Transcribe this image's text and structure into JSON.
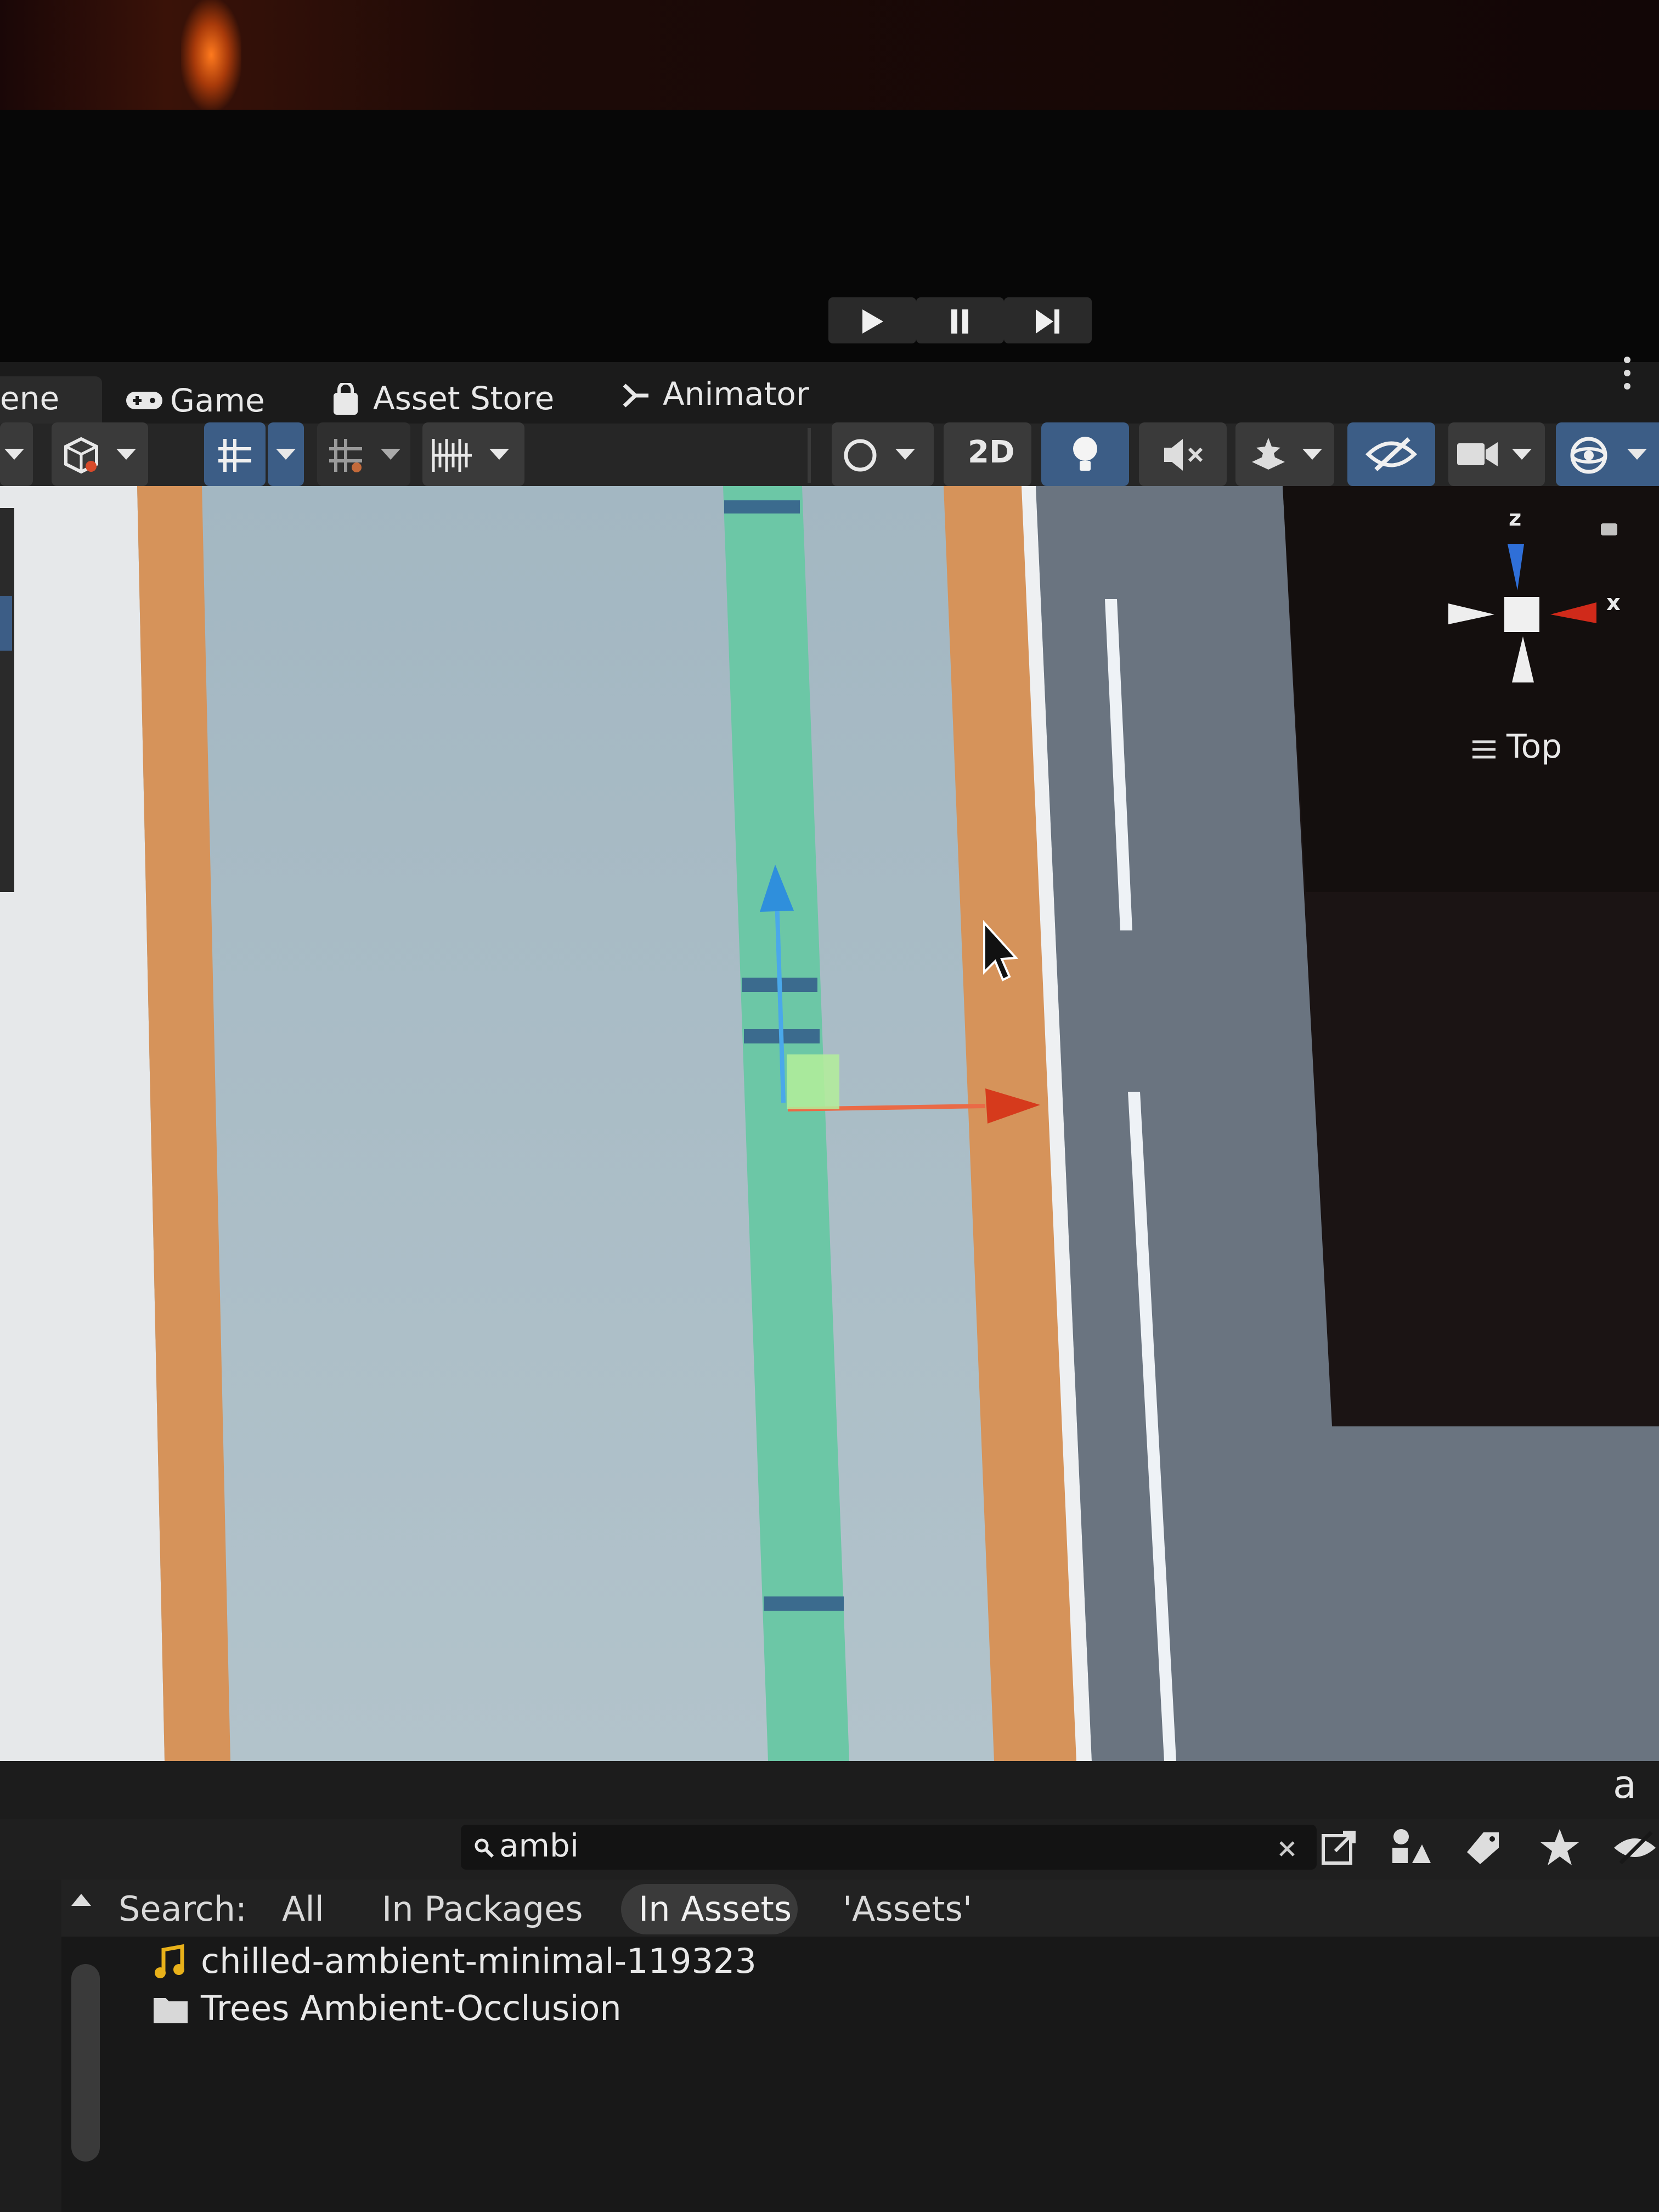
{
  "playbar": {
    "play_icon": "play-icon",
    "pause_icon": "pause-icon",
    "step_icon": "step-icon"
  },
  "tabs": [
    {
      "label": "ene",
      "icon": "scene-icon"
    },
    {
      "label": "Game",
      "icon": "gamepad-icon"
    },
    {
      "label": "Asset Store",
      "icon": "shopping-bag-icon"
    },
    {
      "label": "Animator",
      "icon": "animator-icon"
    }
  ],
  "scene_toolbar": {
    "label_2d": "2D",
    "items": [
      "draw-mode-icon",
      "grid-snap-icon",
      "grid-icon",
      "increment-snap-icon",
      "shading-mode-icon",
      "lighting-icon",
      "audio-icon",
      "effects-icon",
      "hidden-objects-icon",
      "camera-icon",
      "gizmos-icon"
    ]
  },
  "gizmo": {
    "axis_z": "z",
    "axis_x": "x",
    "view_label": "Top"
  },
  "project": {
    "search_value": "ambi",
    "search_label": "Search:",
    "scopes": [
      "All",
      "In Packages",
      "In Assets",
      "'Assets'"
    ],
    "active_scope": "In Assets",
    "results": [
      {
        "name": "chilled-ambient-minimal-119323",
        "icon": "audio-clip-icon"
      },
      {
        "name": "Trees Ambient-Occlusion",
        "icon": "folder-icon"
      }
    ],
    "lock_label": "a"
  },
  "colors": {
    "accent_blue": "#3c5d86",
    "road_orange": "#d8965c",
    "path_green": "#6cc7a6",
    "grass_gray": "#a8bcc6",
    "asphalt": "#6a7480"
  }
}
